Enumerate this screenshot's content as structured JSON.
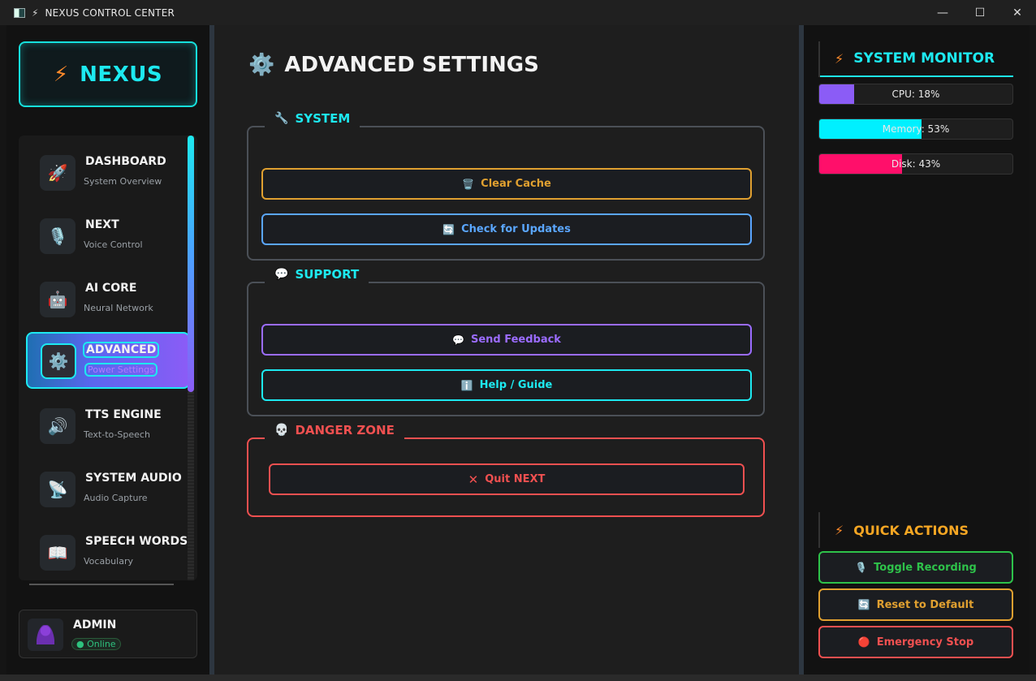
{
  "window": {
    "title": "NEXUS CONTROL CENTER"
  },
  "logo": {
    "name": "NEXUS",
    "bolt_icon": "lightning-icon"
  },
  "nav": {
    "items": [
      {
        "label": "DASHBOARD",
        "sub": "System Overview",
        "icon": "🚀"
      },
      {
        "label": "NEXT",
        "sub": "Voice Control",
        "icon": "🎙️"
      },
      {
        "label": "AI CORE",
        "sub": "Neural Network",
        "icon": "🤖"
      },
      {
        "label": "ADVANCED",
        "sub": "Power Settings",
        "icon": "⚙️"
      },
      {
        "label": "TTS ENGINE",
        "sub": "Text-to-Speech",
        "icon": "🔊"
      },
      {
        "label": "SYSTEM AUDIO",
        "sub": "Audio Capture",
        "icon": "📡"
      },
      {
        "label": "SPEECH WORDS",
        "sub": "Vocabulary",
        "icon": "📖"
      }
    ],
    "active": "ADVANCED"
  },
  "user": {
    "name": "ADMIN",
    "status": "● Online"
  },
  "main": {
    "title": "ADVANCED SETTINGS",
    "title_icon": "⚙️",
    "groups": {
      "system": {
        "label": "SYSTEM",
        "icon": "🔧",
        "buttons": [
          {
            "label": "Clear Cache",
            "icon": "🗑️",
            "color": "#e0a030"
          },
          {
            "label": "Check for Updates",
            "icon": "🔄",
            "color": "#5aa6ff"
          }
        ]
      },
      "support": {
        "label": "SUPPORT",
        "icon": "💬",
        "buttons": [
          {
            "label": "Send Feedback",
            "icon": "💬",
            "color": "#9b6cff"
          },
          {
            "label": "Help / Guide",
            "icon": "ℹ️",
            "color": "#1de9f0"
          }
        ]
      },
      "danger": {
        "label": "DANGER ZONE",
        "icon": "💀",
        "buttons": [
          {
            "label": "Quit NEXT",
            "icon": "✕",
            "color": "#f05050"
          }
        ]
      }
    }
  },
  "monitor": {
    "title": "SYSTEM MONITOR",
    "bars": [
      {
        "label": "CPU: 18%",
        "value": 18,
        "color": "#8b5cf6"
      },
      {
        "label": "Memory: 53%",
        "value": 53,
        "color": "#00f0ff"
      },
      {
        "label": "Disk: 43%",
        "value": 43,
        "color": "#ff0f6a"
      }
    ]
  },
  "quick": {
    "title": "QUICK ACTIONS",
    "buttons": [
      {
        "label": "Toggle Recording",
        "icon": "🎙️",
        "color": "#2ec24a"
      },
      {
        "label": "Reset to Default",
        "icon": "🔄",
        "color": "#e0a030"
      },
      {
        "label": "Emergency Stop",
        "icon": "🔴",
        "color": "#f05050"
      }
    ]
  },
  "colors": {
    "accent": "#1de9f0",
    "orange": "#ff8a2a",
    "danger": "#f05050"
  }
}
